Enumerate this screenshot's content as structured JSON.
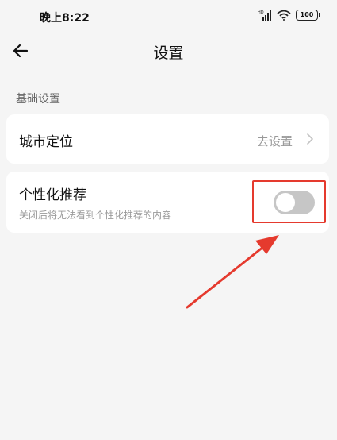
{
  "status_bar": {
    "time": "晚上8:22",
    "battery": "100"
  },
  "header": {
    "title": "设置"
  },
  "section": {
    "label": "基础设置"
  },
  "city_location": {
    "label": "城市定位",
    "action": "去设置"
  },
  "personalized": {
    "label": "个性化推荐",
    "description": "关闭后将无法看到个性化推荐的内容",
    "enabled": false
  },
  "colors": {
    "background": "#f5f5f5",
    "card": "#ffffff",
    "toggle_off": "#c6c6c6",
    "annotation_red": "#e53a2e"
  },
  "icons": [
    "back-arrow-icon",
    "chevron-right-icon",
    "signal-icon",
    "wifi-icon",
    "battery-icon"
  ]
}
